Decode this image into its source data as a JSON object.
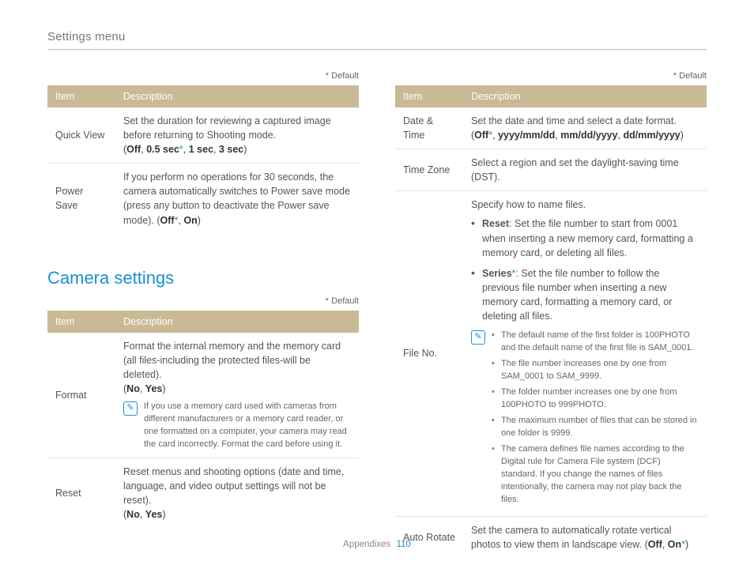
{
  "header": {
    "breadcrumb": "Settings menu"
  },
  "labels": {
    "default_note": "* Default",
    "col_item": "Item",
    "col_desc": "Description"
  },
  "section2": {
    "title": "Camera settings"
  },
  "left_a": {
    "rows": [
      {
        "item": "Quick View",
        "desc": "Set the duration for reviewing a captured image before returning to Shooting mode.",
        "options_prefix": "(",
        "o1": "Off",
        "c1": ", ",
        "o2": "0.5 sec",
        "star2": "*",
        "c2": ", ",
        "o3": "1 sec",
        "c3": ", ",
        "o4": "3 sec",
        "options_suffix": ")"
      },
      {
        "item": "Power Save",
        "desc": "If you perform no operations for 30 seconds, the camera automatically switches to Power save mode (press any button to deactivate the Power save mode). (",
        "o1": "Off",
        "star1": "*",
        "c1": ", ",
        "o2": "On",
        "options_suffix": ")"
      }
    ]
  },
  "left_b": {
    "rows": [
      {
        "item": "Format",
        "desc": "Format the internal memory and the memory card (all files-including the protected files-will be deleted).",
        "options_prefix": "(",
        "o1": "No",
        "c1": ", ",
        "o2": "Yes",
        "options_suffix": ")",
        "note": "If you use a memory card used with cameras from different manufacturers or a memory card reader, or one formatted on a computer, your camera may read the card incorrectly. Format the card before using it."
      },
      {
        "item": "Reset",
        "desc": "Reset menus and shooting options (date and time, language, and video output settings will not be reset).",
        "options_prefix": "(",
        "o1": "No",
        "c1": ", ",
        "o2": "Yes",
        "options_suffix": ")"
      }
    ]
  },
  "right": {
    "rows": [
      {
        "item": "Date & Time",
        "desc": "Set the date and time and select a date format.",
        "options_prefix": "(",
        "o1": "Off",
        "star1": "*",
        "c1": ", ",
        "o2": "yyyy/mm/dd",
        "c2": ", ",
        "o3": "mm/dd/yyyy",
        "c3": ", ",
        "o4": "dd/mm/yyyy",
        "options_suffix": ")"
      },
      {
        "item": "Time Zone",
        "desc": "Select a region and set the daylight-saving time (DST)."
      },
      {
        "item": "File No.",
        "desc": "Specify how to name files.",
        "b1_label": "Reset",
        "b1_text": ": Set the file number to start from 0001 when inserting a new memory card, formatting a memory card, or deleting all files.",
        "b2_label": "Series",
        "b2_star": "*",
        "b2_text": ": Set the file number to follow the previous file number when inserting a new memory card, formatting a memory card, or deleting all files.",
        "notes": [
          "The default name of the first folder is 100PHOTO and the default name of the first file is SAM_0001.",
          "The file number increases one by one from SAM_0001 to SAM_9999.",
          "The folder number increases one by one from 100PHOTO to 999PHOTO.",
          "The maximum number of files that can be stored in one folder is 9999.",
          "The camera defines file names according to the Digital rule for Camera File system (DCF) standard. If you change the names of files intentionally, the camera may not play back the files."
        ]
      },
      {
        "item": "Auto Rotate",
        "desc": "Set the camera to automatically rotate vertical photos to view them in landscape view. (",
        "o1": "Off",
        "c1": ", ",
        "o2": "On",
        "star2": "*",
        "options_suffix": ")"
      }
    ]
  },
  "footer": {
    "section": "Appendixes",
    "page": "110"
  },
  "icons": {
    "note_glyph": "✎"
  }
}
